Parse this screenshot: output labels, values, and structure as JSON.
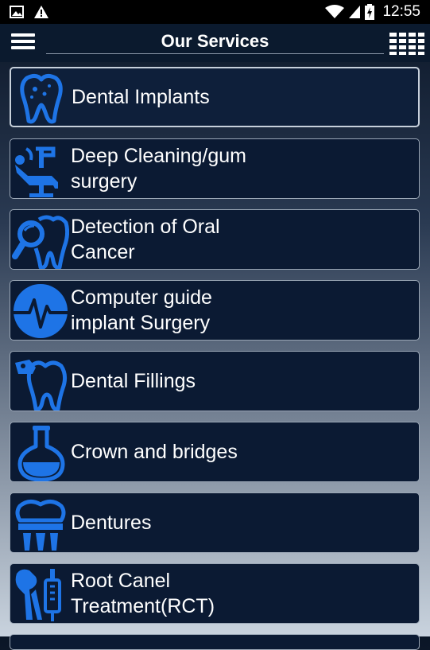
{
  "status_bar": {
    "time": "12:55"
  },
  "header": {
    "title": "Our Services"
  },
  "services": [
    {
      "label": "Dental Implants",
      "icon": "tooth-icon"
    },
    {
      "label": "Deep Cleaning/gum\nsurgery",
      "icon": "dental-chair-icon"
    },
    {
      "label": "Detection of Oral\nCancer",
      "icon": "magnifier-tooth-icon"
    },
    {
      "label": "Computer guide\nimplant Surgery",
      "icon": "heartbeat-icon"
    },
    {
      "label": "Dental Fillings",
      "icon": "filling-tooth-icon"
    },
    {
      "label": "Crown and bridges",
      "icon": "flask-icon"
    },
    {
      "label": "Dentures",
      "icon": "denture-icon"
    },
    {
      "label": "Root Canel\nTreatment(RCT)",
      "icon": "dental-tools-icon"
    }
  ],
  "colors": {
    "accent": "#1e74e6",
    "card_bg": "#0b1a33",
    "topbar_bg": "#0b1a2e"
  }
}
